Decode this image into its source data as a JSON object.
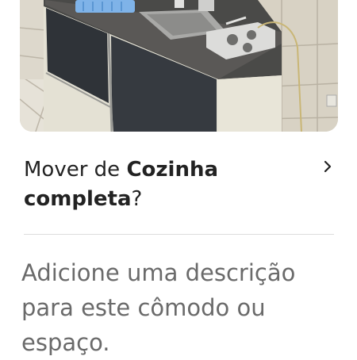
{
  "room_card": {
    "photo_alt": "kitchen-photo",
    "title_prefix": "Mover de ",
    "room_name": "Cozinha completa",
    "title_suffix": "?"
  },
  "description": {
    "placeholder": "Adicione uma descrição para este cômodo ou espaço."
  },
  "icons": {
    "chevron": "chevron-right-icon"
  },
  "colors": {
    "text": "#222222",
    "secondary_text": "#6a6a6a",
    "divider": "#dddddd"
  }
}
